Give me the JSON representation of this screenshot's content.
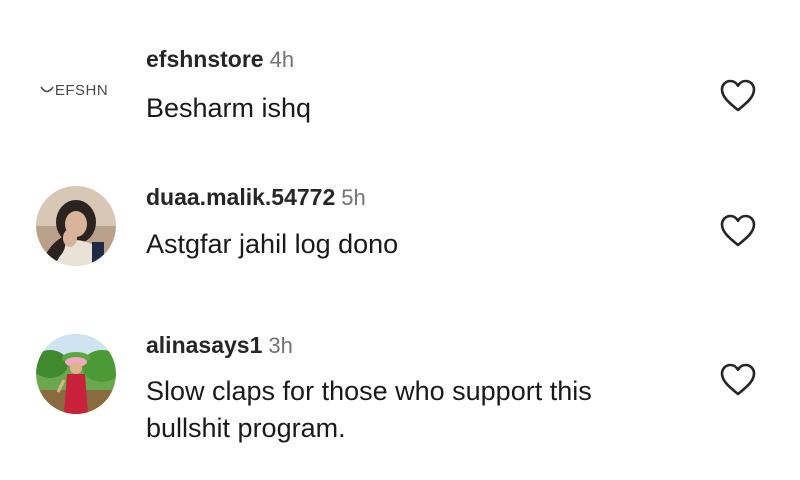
{
  "comments": [
    {
      "avatar_text": "EFSHN",
      "avatar_icon": "efshn-logo-icon",
      "username": "efshnstore",
      "time": "4h",
      "text": "Besharm ishq",
      "like_icon": "heart-outline-icon"
    },
    {
      "avatar_icon": "profile-photo-avatar",
      "username": "duaa.malik.54772",
      "time": "5h",
      "text": "Astgfar jahil log dono",
      "like_icon": "heart-outline-icon"
    },
    {
      "avatar_icon": "profile-photo-avatar",
      "username": "alinasays1",
      "time": "3h",
      "text": "Slow claps for those who support this bullshit program.",
      "like_icon": "heart-outline-icon"
    }
  ],
  "colors": {
    "username": "#262626",
    "timestamp": "#737373",
    "text": "#1a1a1a",
    "icon": "#262626"
  }
}
